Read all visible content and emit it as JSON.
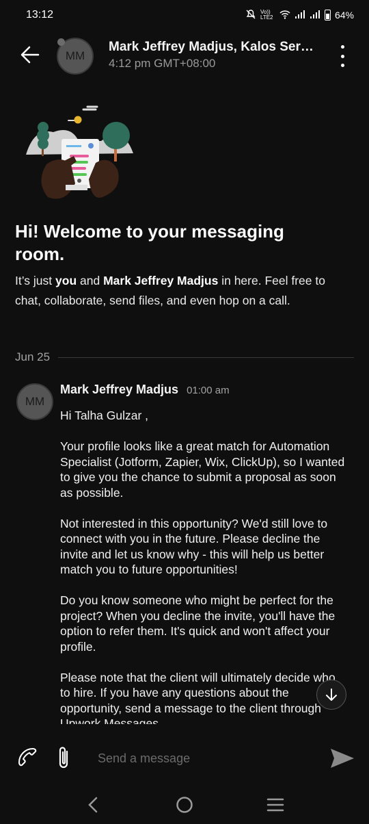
{
  "status_bar": {
    "time": "13:12",
    "network_label": "Vo)) LTE2",
    "battery": "64%"
  },
  "header": {
    "avatar_initials": "MM",
    "title": "Mark Jeffrey Madjus, Kalos Servic...",
    "subtitle": "4:12 pm GMT+08:00"
  },
  "welcome": {
    "title": "Hi! Welcome to your messaging room.",
    "body_pre": "It’s just ",
    "body_you": "you",
    "body_and": " and ",
    "body_name": "Mark Jeffrey Madjus",
    "body_post": " in here. Feel free to chat, collaborate, send files, and even hop on a call."
  },
  "date_separator": "Jun 25",
  "message": {
    "avatar_initials": "MM",
    "sender": "Mark Jeffrey Madjus",
    "time": "01:00 am",
    "paragraphs": [
      "Hi Talha Gulzar ,",
      "Your profile looks like a great match for Automation Specialist (Jotform, Zapier, Wix, ClickUp), so I wanted to give you the chance to submit a proposal as soon as possible.",
      "Not interested in this opportunity? We'd still love to connect with you in the future. Please decline the invite and let us know why - this will help us better match you to future opportunities!",
      "Do you know someone who might be perfect for the project? When you decline the invite, you'll have the option to refer them. It's quick and won't affect your profile.",
      "Please note that the client will ultimately decide who to hire. If you have any questions about the opportunity, send a message to the client through Upwork Messages."
    ]
  },
  "composer": {
    "placeholder": "Send a message"
  },
  "icons": {
    "back": "arrow-left-icon",
    "more": "kebab-icon",
    "call": "phone-icon",
    "attach": "paperclip-icon",
    "send": "send-icon",
    "scroll_down": "arrow-down-icon"
  },
  "colors": {
    "background": "#0f0f0f",
    "avatar": "#555555",
    "muted_text": "#9a9a9a"
  }
}
